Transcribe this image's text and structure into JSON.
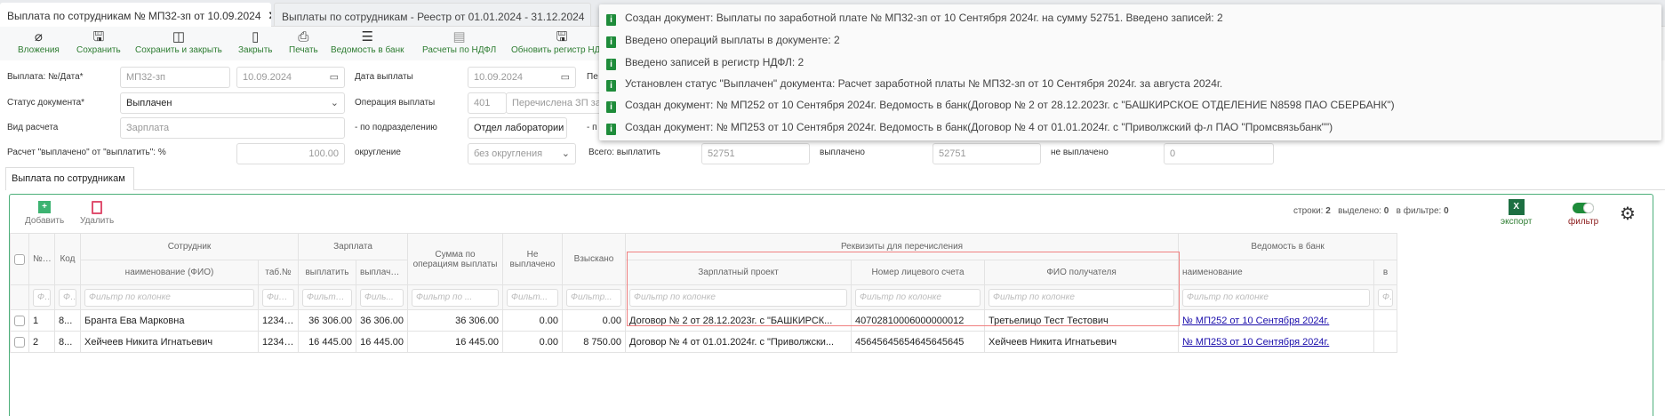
{
  "tabs": [
    {
      "label": "Выплата по сотрудникам № МП32-зп от 10.09.2024"
    },
    {
      "label": "Выплаты по сотрудникам - Реестр от 01.01.2024 - 31.12.2024"
    }
  ],
  "toolbar": {
    "attachments": "Вложения",
    "save": "Сохранить",
    "save_close": "Сохранить и закрыть",
    "close": "Закрыть",
    "print": "Печать",
    "bank": "Ведомость в банк",
    "ndfl": "Расчеты по НДФЛ",
    "update_ndfl": "Обновить регистр НДФЛ"
  },
  "form": {
    "payment_label": "Выплата: №/Дата*",
    "number": "МП32-зп",
    "date": "10.09.2024",
    "pay_date_label": "Дата выплаты",
    "pay_date": "10.09.2024",
    "period_label": "Пе",
    "status_label": "Статус документа*",
    "status": "Выплачен",
    "operation_label": "Операция выплаты",
    "operation_code": "401",
    "operation_name": "Перечислена ЗП за",
    "calc_type_label": "Вид расчета",
    "calc_type": "Зарплата",
    "dept_label": "- по подразделению",
    "dept": "Отдел лаборатории",
    "by_label": "- п",
    "percent_label": "Расчет \"выплачено\" от \"выплатить\": %",
    "percent": "100.00",
    "rounding_label": "округление",
    "rounding": "без округления",
    "total_label": "Всего: выплатить",
    "total": "52751",
    "paid_label": "выплачено",
    "paid": "52751",
    "unpaid_label": "не выплачено",
    "unpaid": "0"
  },
  "notifications": [
    "Создан документ: Выплаты по заработной плате № МП32-зп от 10 Сентября 2024г. на сумму 52751. Введено записей: 2",
    "Введено операций выплаты в документе: 2",
    "Введено записей в регистр НДФЛ: 2",
    "Установлен статус \"Выплачен\" документа: Расчет заработной платы № МП32-зп от 10 Сентября 2024г. за августа 2024г.",
    "Создан документ: № МП252 от 10 Сентября 2024г. Ведомость в банк(Договор № 2 от 28.12.2023г. с \"БАШКИРСКОЕ ОТДЕЛЕНИЕ N8598 ПАО СБЕРБАНК\")",
    "Создан документ: № МП253 от 10 Сентября 2024г. Ведомость в банк(Договор № 4 от 01.01.2024г. с \"Приволжский ф-л ПАО \"Промсвязьбанк\"\")"
  ],
  "subtab": "Выплата по сотрудникам",
  "grid": {
    "add": "Добавить",
    "delete": "Удалить",
    "rows_label": "строки:",
    "rows": "2",
    "selected_label": "выделено:",
    "selected": "0",
    "filtered_label": "в фильтре:",
    "filtered": "0",
    "export": "экспорт",
    "filter": "фильтр",
    "export_icon": "X"
  },
  "headers": {
    "num": "№ п/п",
    "code": "Код",
    "employee": "Сотрудник",
    "fio": "наименование (ФИО)",
    "tab": "таб.№",
    "salary": "Зарплата",
    "to_pay": "выплатить",
    "paid": "выплачено",
    "ops_sum": "Сумма по операциям выплаты",
    "unpaid": "Не выплачено",
    "recovered": "Взыскано",
    "requisites": "Реквизиты для перечисления",
    "project": "Зарплатный проект",
    "account": "Номер лицевого счета",
    "recipient": "ФИО получателя",
    "bank_sheet": "Ведомость в банк",
    "name": "наименование",
    "next": "в"
  },
  "filters": {
    "short": "Ф..",
    "fio": "Фильтр по колонке",
    "tab": "Филь...",
    "to_pay": "Фильтр ...",
    "paid": "Филь...",
    "ops": "Фильтр по ...",
    "unpaid": "Фильт...",
    "recovered": "Фильтр...",
    "full": "Фильтр по колонке",
    "next": "Фи"
  },
  "rows": [
    {
      "num": "1",
      "code": "8...",
      "fio": "Бранта Ева Марковна",
      "tab": "123412...",
      "to_pay": "36 306.00",
      "paid": "36 306.00",
      "ops": "36 306.00",
      "unpaid": "0.00",
      "recovered": "0.00",
      "project": "Договор № 2 от 28.12.2023г. с \"БАШКИРСК...",
      "account": "40702810006000000012",
      "recipient": "Третьелицо Тест Тестович",
      "sheet": "№ МП252 от 10 Сентября 2024г."
    },
    {
      "num": "2",
      "code": "8...",
      "fio": "Хейчеев Никита Игнатьевич",
      "tab": "123412...",
      "to_pay": "16 445.00",
      "paid": "16 445.00",
      "ops": "16 445.00",
      "unpaid": "0.00",
      "recovered": "8 750.00",
      "project": "Договор № 4 от 01.01.2024г. с \"Приволжски...",
      "account": "45645645654645645645",
      "recipient": "Хейчеев Никита Игнатьевич",
      "sheet": "№ МП253 от 10 Сентября 2024г."
    }
  ]
}
